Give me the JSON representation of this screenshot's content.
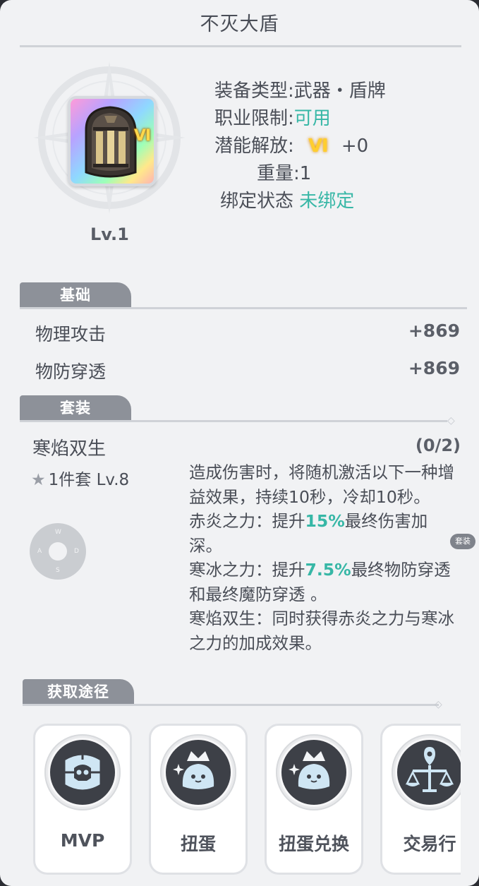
{
  "window": {
    "title": "不灭大盾"
  },
  "item": {
    "tier_badge": "Ⅵ",
    "level": "Lv.1",
    "attributes": [
      {
        "label": "装备类型:",
        "value": "武器・盾牌"
      },
      {
        "label": "职业限制:",
        "value": "可用"
      },
      {
        "label": "潜能解放:",
        "tier": "Ⅵ",
        "value": "+0"
      },
      {
        "label": "重量:",
        "value": "1"
      },
      {
        "label": "绑定状态",
        "value": "未绑定"
      }
    ]
  },
  "basic": {
    "tab_label": "基础",
    "stats": [
      {
        "name": "物理攻击",
        "value": "+869"
      },
      {
        "name": "物防穿透",
        "value": "+869"
      }
    ]
  },
  "set": {
    "tab_label": "套装",
    "name": "寒焰双生",
    "count": "(0/2)",
    "piece": "1件套 Lv.8",
    "description": [
      {
        "text": "造成伤害时，将随机激活以下一种增益效果，持续10秒，冷却10秒。"
      },
      {
        "before": "赤炎之力：提升",
        "highlight": "15%",
        "after": "最终伤害加深。"
      },
      {
        "before": "寒冰之力：提升",
        "highlight": "7.5%",
        "after": "最终物防穿透和最终魔防穿透 。"
      },
      {
        "text": "寒焰双生：同时获得赤炎之力与寒冰之力的加成效果。"
      }
    ]
  },
  "wasd": {
    "w": "W",
    "a": "A",
    "s": "S",
    "d": "D"
  },
  "side_tag": "套装",
  "sources": {
    "tab_label": "获取途径",
    "items": [
      {
        "label": "MVP",
        "icon": "skull-shield-icon"
      },
      {
        "label": "扭蛋",
        "icon": "crowned-slime-icon"
      },
      {
        "label": "扭蛋兑换",
        "icon": "crowned-slime-icon"
      },
      {
        "label": "交易行",
        "icon": "scales-icon"
      }
    ]
  },
  "colors": {
    "accent": "#37b7a6",
    "tab": "#8d9199",
    "panel": "#f1f2f4",
    "tier": "#ffce2e"
  }
}
